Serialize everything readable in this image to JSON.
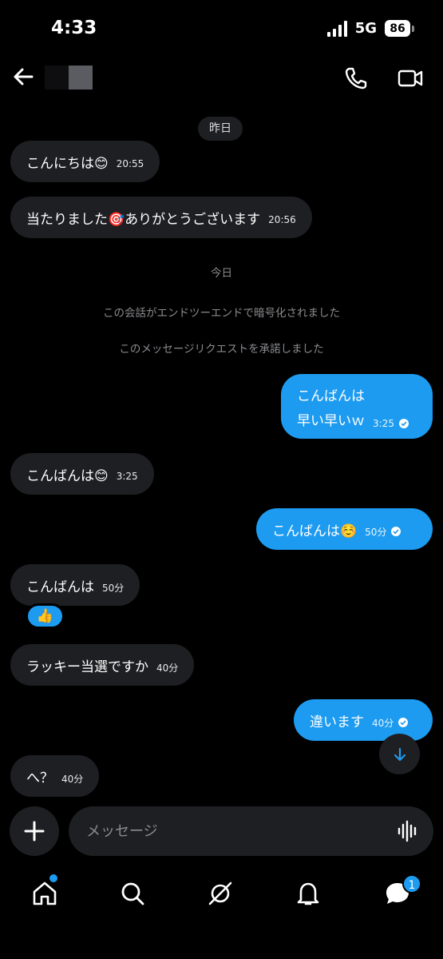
{
  "status": {
    "time": "4:33",
    "network": "5G",
    "battery": "86"
  },
  "colors": {
    "accent": "#1d9bf0",
    "bubble_in": "#1e1f22",
    "background": "#000000"
  },
  "labels": {
    "yesterday": "昨日",
    "today": "今日",
    "encrypted": "この会話がエンドツーエンドで暗号化されました",
    "accepted": "このメッセージリクエストを承諾しました"
  },
  "messages": [
    {
      "dir": "in",
      "text": "こんにちは😊",
      "time": "20:55"
    },
    {
      "dir": "in",
      "text": "当たりました🎯ありがとうございます",
      "time": "20:56"
    },
    {
      "dir": "out",
      "lines": [
        "こんばんは",
        "早い早いｗ"
      ],
      "time": "3:25",
      "read": true
    },
    {
      "dir": "in",
      "text": "こんばんは😊",
      "time": "3:25"
    },
    {
      "dir": "out",
      "text": "こんばんは☺️",
      "time": "50分",
      "read": true
    },
    {
      "dir": "in",
      "text": "こんばんは",
      "time": "50分",
      "reaction": "👍"
    },
    {
      "dir": "in",
      "text": "ラッキー当選ですか",
      "time": "40分"
    },
    {
      "dir": "out",
      "text": "違います",
      "time": "40分",
      "read": true
    },
    {
      "dir": "in",
      "text": "へ？",
      "time": "40分"
    }
  ],
  "composer": {
    "placeholder": "メッセージ"
  },
  "icons": {
    "back": "back-arrow-icon",
    "call": "phone-icon",
    "video": "video-camera-icon",
    "plus": "plus-icon",
    "voice": "voice-waveform-icon",
    "scroll": "arrow-down-icon",
    "home": "home-icon",
    "search": "search-icon",
    "grok": "grok-icon",
    "notifications": "bell-icon",
    "messages": "messages-icon"
  },
  "tabbar": {
    "messages_badge": "1"
  }
}
